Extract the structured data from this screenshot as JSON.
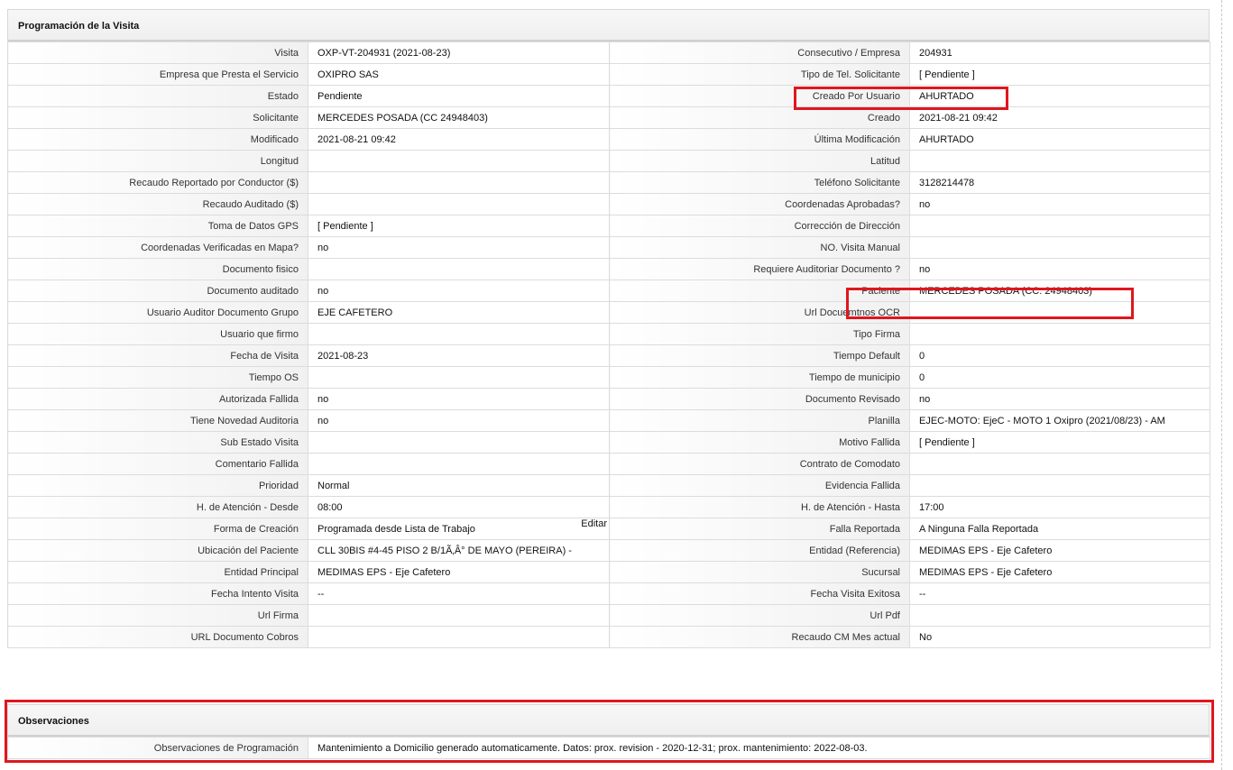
{
  "programacion": {
    "title": "Programación de la Visita",
    "rows": [
      {
        "l1": "Visita",
        "v1": "OXP-VT-204931 (2021-08-23)",
        "l2": "Consecutivo / Empresa",
        "v2": "204931"
      },
      {
        "l1": "Empresa que Presta el Servicio",
        "v1": "OXIPRO SAS",
        "l2": "Tipo de Tel. Solicitante",
        "v2": "[ Pendiente ]"
      },
      {
        "l1": "Estado",
        "v1": "Pendiente",
        "l2": "Creado Por Usuario",
        "v2": "AHURTADO"
      },
      {
        "l1": "Solicitante",
        "v1": "MERCEDES POSADA (CC 24948403)",
        "l2": "Creado",
        "v2": "2021-08-21 09:42"
      },
      {
        "l1": "Modificado",
        "v1": "2021-08-21 09:42",
        "l2": "Última Modificación",
        "v2": " AHURTADO"
      },
      {
        "l1": "Longitud",
        "v1": "",
        "l2": "Latitud",
        "v2": ""
      },
      {
        "l1": "Recaudo Reportado por Conductor ($)",
        "v1": "",
        "l2": "Teléfono Solicitante",
        "v2": "3128214478"
      },
      {
        "l1": "Recaudo Auditado ($)",
        "v1": "",
        "l2": "Coordenadas Aprobadas?",
        "v2": " no"
      },
      {
        "l1": "Toma de Datos GPS",
        "v1": "[ Pendiente ]",
        "l2": "Corrección de Dirección",
        "v2": ""
      },
      {
        "l1": "Coordenadas Verificadas en Mapa?",
        "v1": " no",
        "l2": "NO. Visita Manual",
        "v2": ""
      },
      {
        "l1": "Documento fisico",
        "v1": "",
        "l2": "Requiere Auditoriar Documento ?",
        "v2": " no"
      },
      {
        "l1": "Documento auditado",
        "v1": "no",
        "l2": "Paciente",
        "v2": "MERCEDES POSADA (CC: 24948403)"
      },
      {
        "l1": "Usuario Auditor Documento Grupo",
        "v1": "EJE CAFETERO",
        "l2": "Url Docuemtnos OCR",
        "v2": ""
      },
      {
        "l1": "Usuario que firmo",
        "v1": "",
        "l2": "Tipo Firma",
        "v2": ""
      },
      {
        "l1": "Fecha de Visita",
        "v1": " 2021-08-23",
        "l2": "Tiempo Default",
        "v2": "0"
      },
      {
        "l1": "Tiempo OS",
        "v1": "",
        "l2": "Tiempo de municipio",
        "v2": "0"
      },
      {
        "l1": "Autorizada Fallida",
        "v1": " no",
        "l2": "Documento Revisado",
        "v2": " no"
      },
      {
        "l1": "Tiene Novedad Auditoria",
        "v1": " no",
        "l2": "Planilla",
        "v2": "EJEC-MOTO: EjeC - MOTO 1 Oxipro (2021/08/23) - AM"
      },
      {
        "l1": "Sub Estado Visita",
        "v1": "",
        "l2": "Motivo Fallida",
        "v2": "[ Pendiente ]"
      },
      {
        "l1": "Comentario Fallida",
        "v1": "",
        "l2": "Contrato de Comodato",
        "v2": ""
      },
      {
        "l1": "Prioridad",
        "v1": "Normal",
        "l2": "Evidencia Fallida",
        "v2": ""
      },
      {
        "l1": "H. de Atención - Desde",
        "v1": "08:00",
        "l2": "H. de Atención - Hasta",
        "v2": "17:00"
      },
      {
        "l1": "Forma de Creación",
        "v1": "Programada desde Lista de Trabajo",
        "edit": "Editar",
        "l2": "Falla Reportada",
        "v2": "A Ninguna Falla Reportada"
      },
      {
        "l1": "Ubicación del Paciente",
        "v1": "CLL 30BIS #4-45 PISO 2 B/1Ã‚Â° DE MAYO (PEREIRA) -",
        "l2": "Entidad (Referencia)",
        "v2": "MEDIMAS EPS - Eje Cafetero"
      },
      {
        "l1": "Entidad Principal",
        "v1": "MEDIMAS EPS - Eje Cafetero",
        "l2": "Sucursal",
        "v2": "MEDIMAS EPS - Eje Cafetero"
      },
      {
        "l1": "Fecha Intento Visita",
        "v1": " --",
        "l2": "Fecha Visita Exitosa",
        "v2": " --"
      },
      {
        "l1": "Url Firma",
        "v1": "",
        "l2": "Url Pdf",
        "v2": ""
      },
      {
        "l1": "URL Documento Cobros",
        "v1": "",
        "l2": "Recaudo CM Mes actual",
        "v2": "No"
      }
    ]
  },
  "observaciones": {
    "title": "Observaciones",
    "label": "Observaciones de Programación",
    "value": " Mantenimiento a Domicilio generado automaticamente. Datos: prox. revision - 2020-12-31; prox. mantenimiento: 2022-08-03."
  },
  "highlight_color": "#e0161e"
}
